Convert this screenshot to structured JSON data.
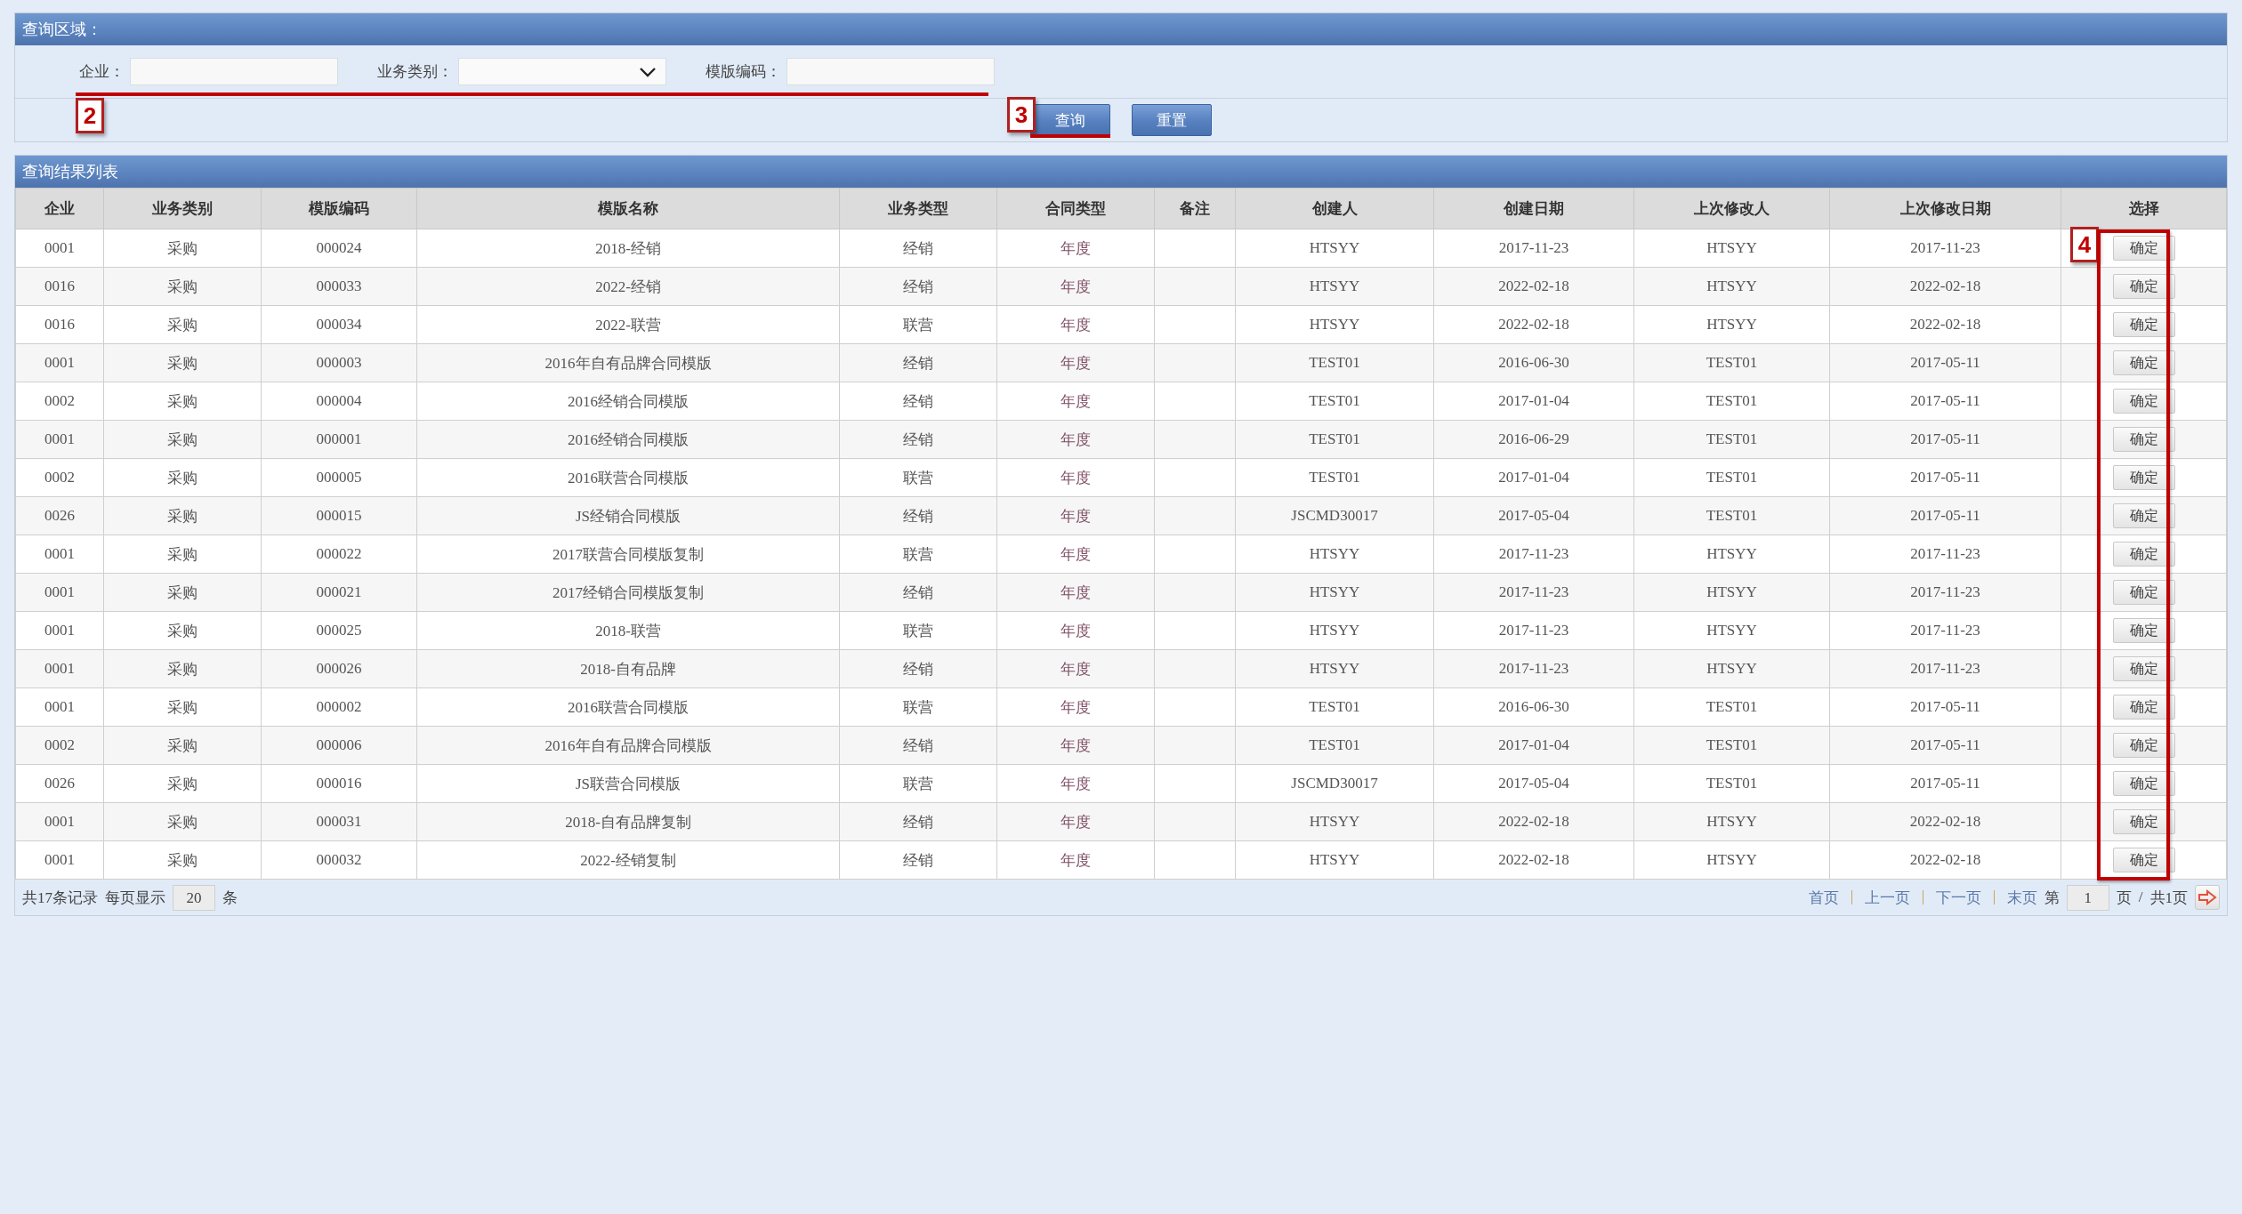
{
  "query_panel": {
    "title": "查询区域：",
    "fields": [
      {
        "kind": "text",
        "label": "企业："
      },
      {
        "kind": "select",
        "label": "业务类别："
      },
      {
        "kind": "text",
        "label": "模版编码："
      }
    ],
    "buttons": [
      "查询",
      "重置"
    ]
  },
  "results": {
    "title": "查询结果列表",
    "columns": [
      {
        "kind": "text",
        "label": "企业"
      },
      {
        "kind": "text",
        "label": "业务类别"
      },
      {
        "kind": "text",
        "label": "模版编码"
      },
      {
        "kind": "text",
        "label": "模版名称"
      },
      {
        "kind": "text",
        "label": "业务类型"
      },
      {
        "kind": "accent",
        "label": "合同类型"
      },
      {
        "kind": "text",
        "label": "备注"
      },
      {
        "kind": "text",
        "label": "创建人"
      },
      {
        "kind": "text",
        "label": "创建日期"
      },
      {
        "kind": "text",
        "label": "上次修改人"
      },
      {
        "kind": "text",
        "label": "上次修改日期"
      },
      {
        "kind": "action",
        "label": "选择"
      }
    ],
    "rows": [
      [
        "0001",
        "采购",
        "000024",
        "2018-经销",
        "经销",
        "年度",
        "",
        "HTSYY",
        "2017-11-23",
        "HTSYY",
        "2017-11-23",
        "确定"
      ],
      [
        "0016",
        "采购",
        "000033",
        "2022-经销",
        "经销",
        "年度",
        "",
        "HTSYY",
        "2022-02-18",
        "HTSYY",
        "2022-02-18",
        "确定"
      ],
      [
        "0016",
        "采购",
        "000034",
        "2022-联营",
        "联营",
        "年度",
        "",
        "HTSYY",
        "2022-02-18",
        "HTSYY",
        "2022-02-18",
        "确定"
      ],
      [
        "0001",
        "采购",
        "000003",
        "2016年自有品牌合同模版",
        "经销",
        "年度",
        "",
        "TEST01",
        "2016-06-30",
        "TEST01",
        "2017-05-11",
        "确定"
      ],
      [
        "0002",
        "采购",
        "000004",
        "2016经销合同模版",
        "经销",
        "年度",
        "",
        "TEST01",
        "2017-01-04",
        "TEST01",
        "2017-05-11",
        "确定"
      ],
      [
        "0001",
        "采购",
        "000001",
        "2016经销合同模版",
        "经销",
        "年度",
        "",
        "TEST01",
        "2016-06-29",
        "TEST01",
        "2017-05-11",
        "确定"
      ],
      [
        "0002",
        "采购",
        "000005",
        "2016联营合同模版",
        "联营",
        "年度",
        "",
        "TEST01",
        "2017-01-04",
        "TEST01",
        "2017-05-11",
        "确定"
      ],
      [
        "0026",
        "采购",
        "000015",
        "JS经销合同模版",
        "经销",
        "年度",
        "",
        "JSCMD30017",
        "2017-05-04",
        "TEST01",
        "2017-05-11",
        "确定"
      ],
      [
        "0001",
        "采购",
        "000022",
        "2017联营合同模版复制",
        "联营",
        "年度",
        "",
        "HTSYY",
        "2017-11-23",
        "HTSYY",
        "2017-11-23",
        "确定"
      ],
      [
        "0001",
        "采购",
        "000021",
        "2017经销合同模版复制",
        "经销",
        "年度",
        "",
        "HTSYY",
        "2017-11-23",
        "HTSYY",
        "2017-11-23",
        "确定"
      ],
      [
        "0001",
        "采购",
        "000025",
        "2018-联营",
        "联营",
        "年度",
        "",
        "HTSYY",
        "2017-11-23",
        "HTSYY",
        "2017-11-23",
        "确定"
      ],
      [
        "0001",
        "采购",
        "000026",
        "2018-自有品牌",
        "经销",
        "年度",
        "",
        "HTSYY",
        "2017-11-23",
        "HTSYY",
        "2017-11-23",
        "确定"
      ],
      [
        "0001",
        "采购",
        "000002",
        "2016联营合同模版",
        "联营",
        "年度",
        "",
        "TEST01",
        "2016-06-30",
        "TEST01",
        "2017-05-11",
        "确定"
      ],
      [
        "0002",
        "采购",
        "000006",
        "2016年自有品牌合同模版",
        "经销",
        "年度",
        "",
        "TEST01",
        "2017-01-04",
        "TEST01",
        "2017-05-11",
        "确定"
      ],
      [
        "0026",
        "采购",
        "000016",
        "JS联营合同模版",
        "联营",
        "年度",
        "",
        "JSCMD30017",
        "2017-05-04",
        "TEST01",
        "2017-05-11",
        "确定"
      ],
      [
        "0001",
        "采购",
        "000031",
        "2018-自有品牌复制",
        "经销",
        "年度",
        "",
        "HTSYY",
        "2022-02-18",
        "HTSYY",
        "2022-02-18",
        "确定"
      ],
      [
        "0001",
        "采购",
        "000032",
        "2022-经销复制",
        "经销",
        "年度",
        "",
        "HTSYY",
        "2022-02-18",
        "HTSYY",
        "2022-02-18",
        "确定"
      ]
    ],
    "pager": {
      "total": "共17条记录",
      "per_page_label": "每页显示",
      "per_page": "20",
      "per_page_unit": "条",
      "links": [
        "首页",
        "上一页",
        "下一页",
        "末页"
      ],
      "page_prefix": "第",
      "page": "1",
      "page_suffix": "页",
      "slash": "/",
      "page_total": "共1页"
    }
  },
  "annotations": [
    {
      "label": "2",
      "kind": "underline"
    },
    {
      "label": "3",
      "kind": "underline"
    },
    {
      "label": "4",
      "kind": "box"
    }
  ]
}
